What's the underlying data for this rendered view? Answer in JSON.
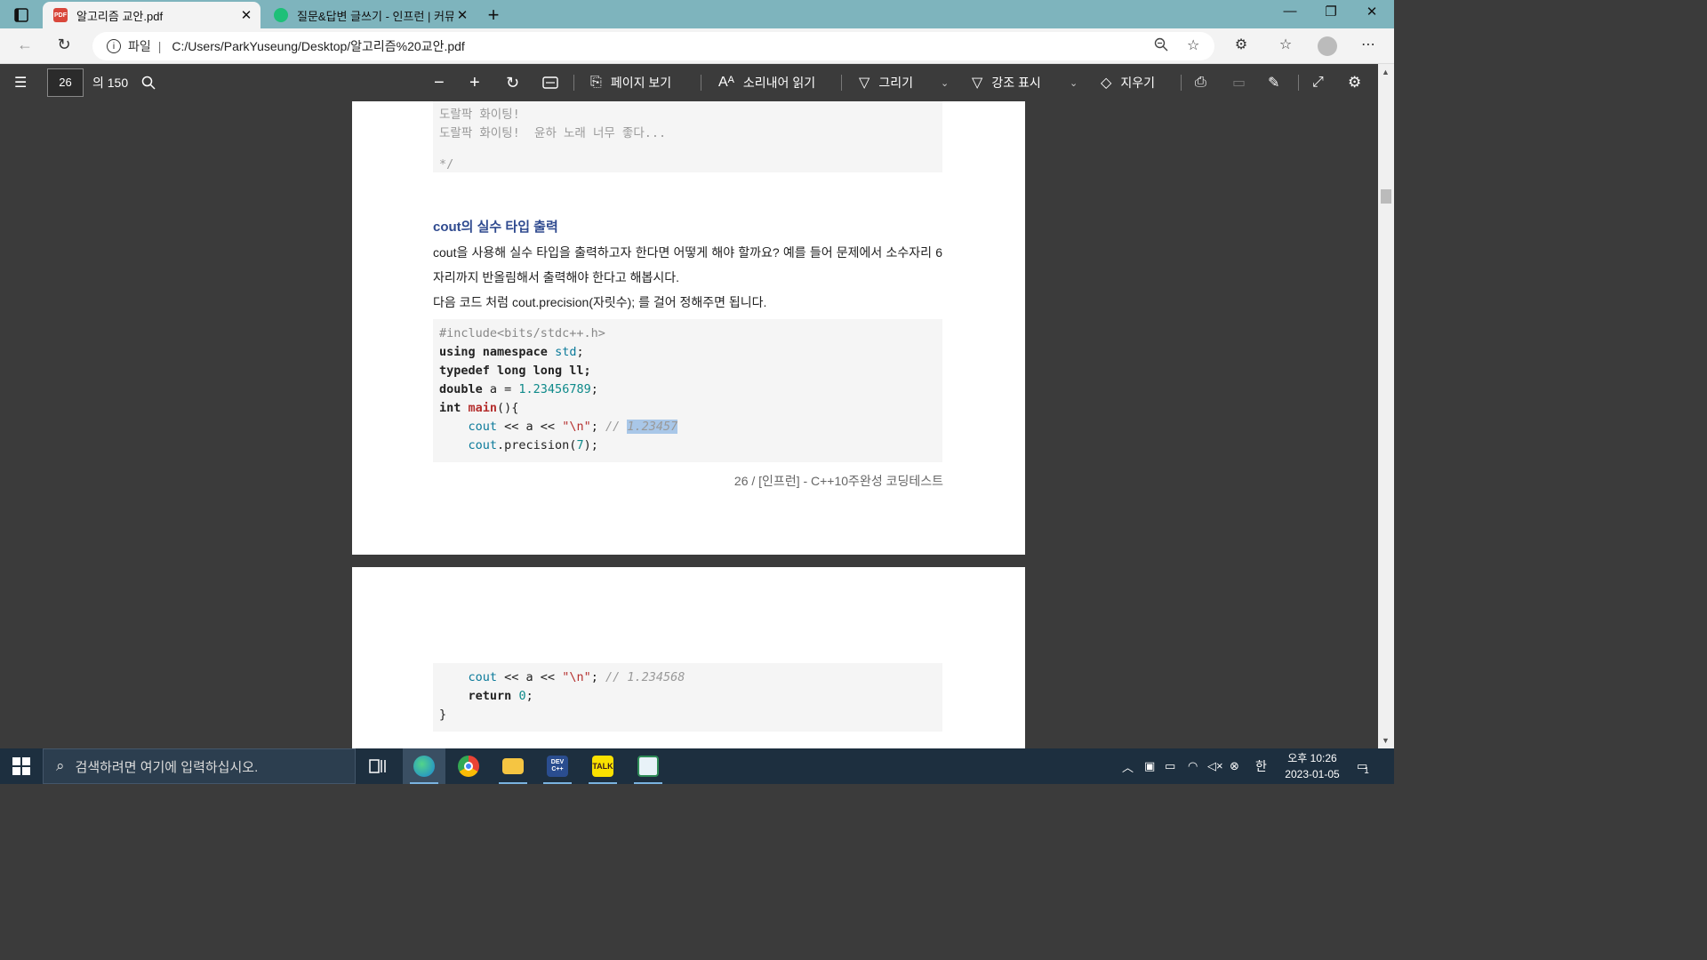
{
  "tabs": [
    {
      "title": "알고리즘 교안.pdf",
      "close": "✕"
    },
    {
      "title": "질문&답변 글쓰기 - 인프런 | 커뮤",
      "close": "✕"
    }
  ],
  "new_tab": "+",
  "window": {
    "minimize": "—",
    "restore": "❐",
    "close": "✕"
  },
  "address": {
    "scheme": "파일",
    "separator": "|",
    "url": "C:/Users/ParkYuseung/Desktop/알고리즘%20교안.pdf"
  },
  "pdf_toolbar": {
    "page_current": "26",
    "page_total": "의 150",
    "page_view": "페이지 보기",
    "read_aloud": "소리내어 읽기",
    "draw": "그리기",
    "highlight": "강조 표시",
    "erase": "지우기"
  },
  "page1": {
    "comment_lines": [
      "도랄팍 화이팅!",
      "도랄팍 화이팅!  윤하 노래 너무 좋다...",
      "",
      "*/"
    ],
    "section_title": "cout의 실수 타입 출력",
    "para1": "cout을 사용해 실수 타입을 출력하고자 한다면 어떻게 해야 할까요? 예를 들어 문제에서 소수자리 6자리까지 반올림해서 출력해야 한다고 해봅시다.",
    "para2": "다음 코드 처럼 cout.precision(자릿수); 를 걸어 정해주면 됩니다.",
    "code": {
      "l1": "#include<bits/stdc++.h>",
      "l2_kw": "using namespace",
      "l2_ty": "std",
      "l2_end": ";",
      "l3": "typedef long long ll;",
      "l4_kw": "double",
      "l4_mid": " a = ",
      "l4_num": "1.23456789",
      "l4_end": ";",
      "l5_kw": "int",
      "l5_fn": "main",
      "l5_end": "(){",
      "l6_ty": "cout",
      "l6_mid": " << a << ",
      "l6_str": "\"\\n\"",
      "l6_semi": "; ",
      "l6_com": "// ",
      "l6_hl": "1.23457",
      "l7_ty": "cout",
      "l7_mid": ".precision(",
      "l7_num": "7",
      "l7_end": ");"
    },
    "footer": "26 / [인프런] - C++10주완성 코딩테스트"
  },
  "page2": {
    "code": {
      "l1_ty": "cout",
      "l1_mid": " << a << ",
      "l1_str": "\"\\n\"",
      "l1_semi": "; ",
      "l1_com": "// 1.234568",
      "l2_kw": "return",
      "l2_num": "0",
      "l2_end": ";",
      "l3": "}"
    }
  },
  "taskbar": {
    "search_placeholder": "검색하려면 여기에 입력하십시오.",
    "ime": "한",
    "time": "오후 10:26",
    "date": "2023-01-05",
    "notifications": "1",
    "apps": [
      "edge-icon",
      "chrome-icon",
      "file-explorer-icon",
      "devc-icon",
      "kakaotalk-icon",
      "notepad-icon"
    ],
    "devc_label": "DEV C++",
    "kakao_label": "TALK"
  },
  "colors": {
    "tabstrip": "#7eb4bd",
    "pdf_toolbar": "#3b3b3b",
    "section_title": "#2f4a8f",
    "taskbar": "#1d2f3f"
  }
}
